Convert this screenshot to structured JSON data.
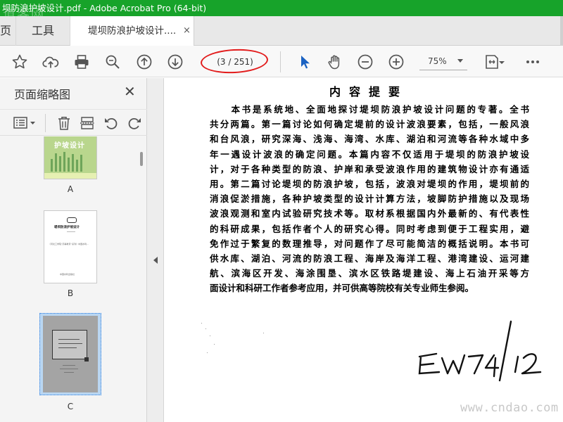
{
  "window": {
    "title": "坝防浪护坡设计.pdf - Adobe Acrobat Pro (64-bit)",
    "watermark": "道客网"
  },
  "tabs": {
    "home_partial": "页",
    "tools": "工具",
    "document": "堤坝防浪护坡设计....",
    "close": "×"
  },
  "toolbar": {
    "page_indicator": "(3 / 251)",
    "zoom": "75%",
    "icons": [
      "star-icon",
      "cloud-upload-icon",
      "print-icon",
      "zoom-search-icon",
      "page-up-icon",
      "page-down-icon",
      "select-arrow-icon",
      "hand-icon",
      "zoom-out-icon",
      "zoom-in-icon",
      "fit-page-icon",
      "more-icon"
    ],
    "annotation_color": "#e21b1b"
  },
  "thumbnails_panel": {
    "title": "页面缩略图",
    "close": "✕",
    "pages": [
      {
        "label": "A",
        "title_text": "护坡设计"
      },
      {
        "label": "B",
        "heading": "堤坝防浪护坡设计",
        "line": "《河北工学院“高等教育”系列》中国水利...",
        "footer": "中国水利出版社"
      },
      {
        "label": "C",
        "selected": true
      }
    ]
  },
  "document": {
    "title": "内容提要",
    "lines": [
      "　　本书是系统地、全面地探讨堤坝防浪护坡设计问题的专著。全书",
      "共分两篇。第一篇讨论如何确定堤前的设计波浪要素，包括，一般风浪",
      "和台风浪，研究深海、浅海、海湾、水库、湖泊和河流等各种水域中多",
      "年一遇设计波浪的确定问题。本篇内容不仅适用于堤坝的防浪护坡设",
      "计，对于各种类型的防浪、护岸和承受波浪作用的建筑物设计亦有通适",
      "用。第二篇讨论堤坝的防浪护坡，包括，波浪对堤坝的作用，堤坝前的",
      "消浪促淤措施，各种护坡类型的设计计算方法，坡脚防护措施以及现场",
      "波浪观测和室内试验研究技术等。取材系根据国内外最新的、有代表性",
      "的科研成果，包括作者个人的研究心得。同时考虑到便于工程实用，避",
      "免作过于繁复的数理推导，对问题作了尽可能简洁的概括说明。本书可",
      "供水库、湖泊、河流的防浪工程、海岸及海洋工程、港湾建设、运河建",
      "航、滨海区开发、海涂围垦、滨水区铁路堤建设、海上石油开采等方",
      "面设计和科研工作者参考应用，并可供高等院校有关专业师生参阅。"
    ],
    "signature": "EW74/12",
    "site_watermark": "www.cndao.com"
  }
}
